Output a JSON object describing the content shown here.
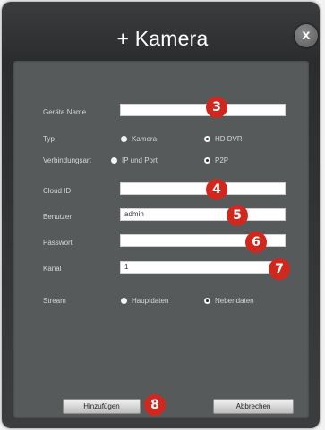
{
  "dialog": {
    "title": "+ Kamera",
    "close_symbol": "x"
  },
  "form": {
    "device_name": {
      "label": "Geräte Name",
      "value": ""
    },
    "type": {
      "label": "Typ",
      "options": [
        "Kamera",
        "HD DVR"
      ],
      "selected": "HD DVR"
    },
    "connection": {
      "label": "Verbindungsart",
      "options": [
        "IP und Port",
        "P2P"
      ],
      "selected": "P2P"
    },
    "cloud_id": {
      "label": "Cloud ID",
      "value": ""
    },
    "username": {
      "label": "Benutzer",
      "value": "admin"
    },
    "password": {
      "label": "Passwort",
      "value": ""
    },
    "channel": {
      "label": "Kanal",
      "value": "1"
    },
    "stream": {
      "label": "Stream",
      "options": [
        "Hauptdaten",
        "Nebendaten"
      ],
      "selected": "Nebendaten"
    }
  },
  "buttons": {
    "add": "Hinzufügen",
    "cancel": "Abbrechen"
  },
  "callouts": [
    "3",
    "4",
    "5",
    "6",
    "7",
    "8"
  ],
  "colors": {
    "callout": "#d0281e",
    "panel": "#575a5a",
    "frame": "#2e3032"
  }
}
